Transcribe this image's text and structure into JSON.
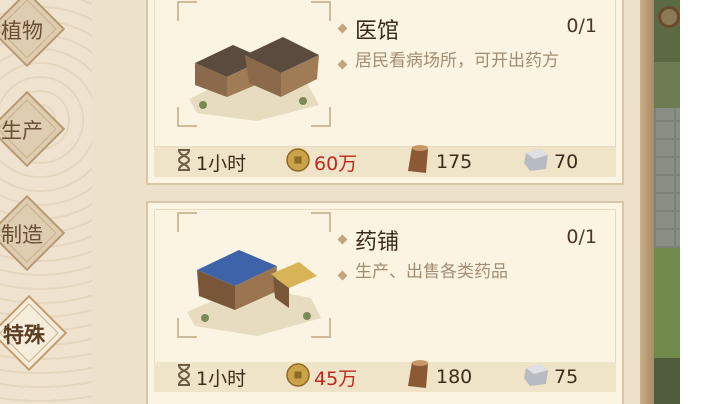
{
  "categories": [
    {
      "label": "植物",
      "active": false
    },
    {
      "label": "生产",
      "active": false
    },
    {
      "label": "制造",
      "active": false
    },
    {
      "label": "特殊",
      "active": true
    }
  ],
  "buildings": [
    {
      "name": "医馆",
      "count": "0/1",
      "description": "居民看病场所，可开出药方",
      "costs": {
        "time": "1小时",
        "coins": "60万",
        "wood": "175",
        "stone": "70"
      },
      "roof_color": "#5b4a3e"
    },
    {
      "name": "药铺",
      "count": "0/1",
      "description": "生产、出售各类药品",
      "costs": {
        "time": "1小时",
        "coins": "45万",
        "wood": "180",
        "stone": "75"
      },
      "roof_color": "#3f63a8"
    }
  ],
  "icons": {
    "time": "hourglass-icon",
    "coins": "coin-icon",
    "wood": "wood-log-icon",
    "stone": "stone-block-icon"
  },
  "colors": {
    "coin_cost": "#c2271f",
    "panel": "#fbf4e2"
  }
}
